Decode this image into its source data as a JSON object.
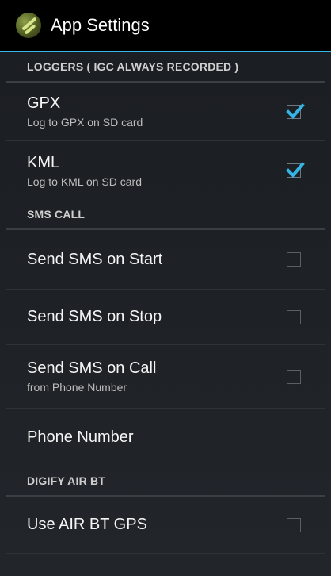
{
  "app": {
    "title": "App Settings"
  },
  "sections": [
    {
      "header": "LOGGERS ( IGC ALWAYS RECORDED )"
    },
    {
      "header": "SMS CALL"
    },
    {
      "header": "DIGIFY AIR BT"
    }
  ],
  "prefs": {
    "gpx": {
      "title": "GPX",
      "summary": "Log to GPX on SD card",
      "checked": true
    },
    "kml": {
      "title": "KML",
      "summary": "Log to KML on SD card",
      "checked": true
    },
    "sms_start": {
      "title": "Send SMS on Start",
      "checked": false
    },
    "sms_stop": {
      "title": "Send SMS on Stop",
      "checked": false
    },
    "sms_call": {
      "title": "Send SMS on Call",
      "summary": "from Phone Number",
      "checked": false
    },
    "phone_number": {
      "title": "Phone Number"
    },
    "air_bt_gps": {
      "title": "Use AIR BT GPS",
      "checked": false
    }
  },
  "colors": {
    "accent": "#33b5e5",
    "actionbar": "#000000",
    "background": "#1e2226"
  }
}
